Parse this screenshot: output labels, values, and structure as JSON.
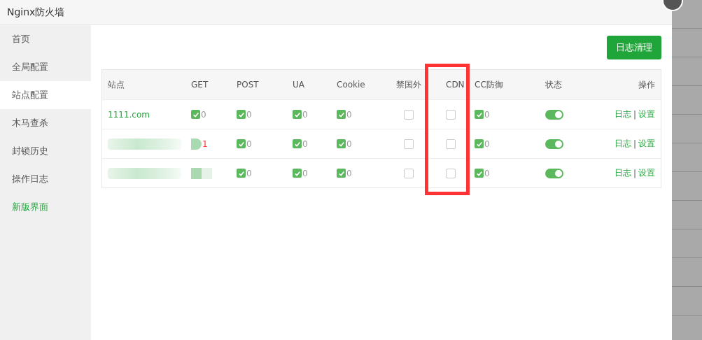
{
  "window": {
    "title": "Nginx防火墙"
  },
  "sidebar": {
    "items": [
      {
        "label": "首页",
        "selected": false,
        "kind": "item"
      },
      {
        "label": "全局配置",
        "selected": false,
        "kind": "item"
      },
      {
        "label": "站点配置",
        "selected": true,
        "kind": "item"
      },
      {
        "label": "木马查杀",
        "selected": false,
        "kind": "item"
      },
      {
        "label": "封锁历史",
        "selected": false,
        "kind": "item"
      },
      {
        "label": "操作日志",
        "selected": false,
        "kind": "item"
      },
      {
        "label": "新版界面",
        "selected": false,
        "kind": "link"
      }
    ]
  },
  "toolbar": {
    "button": "日志清理"
  },
  "table": {
    "columns": [
      {
        "label": "站点",
        "highlighted": false
      },
      {
        "label": "GET",
        "highlighted": false
      },
      {
        "label": "POST",
        "highlighted": false
      },
      {
        "label": "UA",
        "highlighted": false
      },
      {
        "label": "Cookie",
        "highlighted": false
      },
      {
        "label": "禁国外",
        "highlighted": false
      },
      {
        "label": "CDN",
        "highlighted": true
      },
      {
        "label": "CC防御",
        "highlighted": false
      },
      {
        "label": "状态",
        "highlighted": false
      },
      {
        "label": "操作",
        "highlighted": false
      }
    ],
    "rows": [
      {
        "cells": [
          {
            "kind": "site",
            "text": "1111.com"
          },
          {
            "kind": "counter",
            "checked": true,
            "count": "0",
            "alert": false
          },
          {
            "kind": "counter",
            "checked": true,
            "count": "0",
            "alert": false
          },
          {
            "kind": "counter",
            "checked": true,
            "count": "0",
            "alert": false
          },
          {
            "kind": "counter",
            "checked": true,
            "count": "0",
            "alert": false
          },
          {
            "kind": "box",
            "checked": false
          },
          {
            "kind": "box",
            "checked": false
          },
          {
            "kind": "counter",
            "checked": true,
            "count": "0",
            "alert": false
          },
          {
            "kind": "toggle",
            "on": true
          },
          {
            "kind": "actions",
            "links": [
              "日志",
              "设置"
            ],
            "separator": "|"
          }
        ]
      },
      {
        "cells": [
          {
            "kind": "redacted_site"
          },
          {
            "kind": "counter_redacted",
            "count": "1",
            "alert": true
          },
          {
            "kind": "counter",
            "checked": true,
            "count": "0",
            "alert": false
          },
          {
            "kind": "counter",
            "checked": true,
            "count": "0",
            "alert": false
          },
          {
            "kind": "counter",
            "checked": true,
            "count": "0",
            "alert": false
          },
          {
            "kind": "box",
            "checked": false
          },
          {
            "kind": "box",
            "checked": false
          },
          {
            "kind": "counter",
            "checked": true,
            "count": "0",
            "alert": false
          },
          {
            "kind": "toggle",
            "on": true
          },
          {
            "kind": "actions",
            "links": [
              "日志",
              "设置"
            ],
            "separator": "|"
          }
        ]
      },
      {
        "cells": [
          {
            "kind": "redacted_site"
          },
          {
            "kind": "redacted"
          },
          {
            "kind": "counter",
            "checked": true,
            "count": "0",
            "alert": false
          },
          {
            "kind": "counter",
            "checked": true,
            "count": "0",
            "alert": false
          },
          {
            "kind": "counter",
            "checked": true,
            "count": "0",
            "alert": false
          },
          {
            "kind": "box",
            "checked": false
          },
          {
            "kind": "box",
            "checked": false
          },
          {
            "kind": "counter",
            "checked": true,
            "count": "0",
            "alert": false
          },
          {
            "kind": "toggle",
            "on": true
          },
          {
            "kind": "actions",
            "links": [
              "日志",
              "设置"
            ],
            "separator": "|"
          }
        ]
      }
    ]
  }
}
